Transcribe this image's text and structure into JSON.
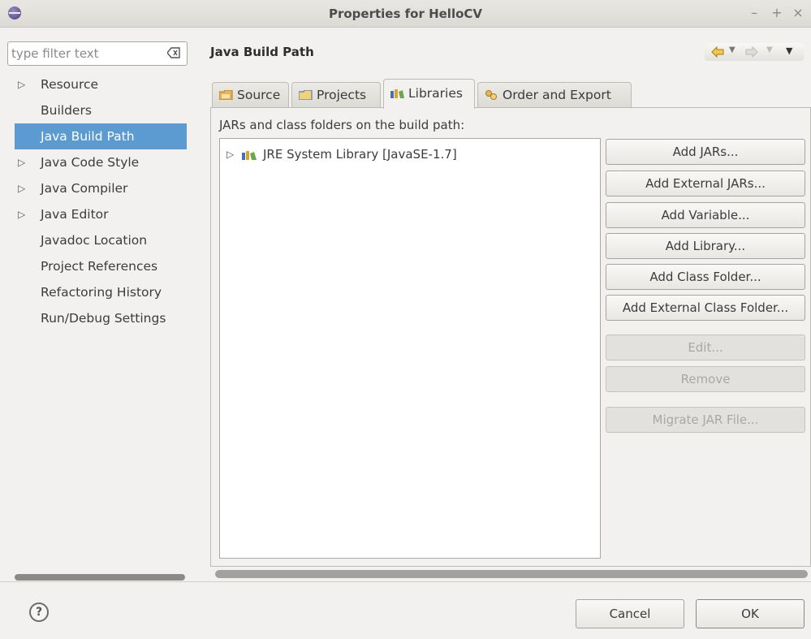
{
  "window": {
    "title": "Properties for HelloCV",
    "controls": [
      "–",
      "+",
      "×"
    ]
  },
  "sidebar": {
    "filter_placeholder": "type filter text",
    "items": [
      {
        "label": "Resource",
        "expandable": true,
        "selected": false
      },
      {
        "label": "Builders",
        "expandable": false,
        "selected": false
      },
      {
        "label": "Java Build Path",
        "expandable": false,
        "selected": true
      },
      {
        "label": "Java Code Style",
        "expandable": true,
        "selected": false
      },
      {
        "label": "Java Compiler",
        "expandable": true,
        "selected": false
      },
      {
        "label": "Java Editor",
        "expandable": true,
        "selected": false
      },
      {
        "label": "Javadoc Location",
        "expandable": false,
        "selected": false
      },
      {
        "label": "Project References",
        "expandable": false,
        "selected": false
      },
      {
        "label": "Refactoring History",
        "expandable": false,
        "selected": false
      },
      {
        "label": "Run/Debug Settings",
        "expandable": false,
        "selected": false
      }
    ]
  },
  "main": {
    "title": "Java Build Path",
    "tabs": [
      {
        "label": "Source",
        "icon": "source-folder-icon",
        "active": false
      },
      {
        "label": "Projects",
        "icon": "projects-icon",
        "active": false
      },
      {
        "label": "Libraries",
        "icon": "libraries-icon",
        "active": true
      },
      {
        "label": "Order and Export",
        "icon": "order-export-icon",
        "active": false
      }
    ],
    "list_label": "JARs and class folders on the build path:",
    "libraries": [
      {
        "label": "JRE System Library [JavaSE-1.7]",
        "icon": "library-icon"
      }
    ],
    "buttons": [
      {
        "label": "Add JARs...",
        "enabled": true
      },
      {
        "label": "Add External JARs...",
        "enabled": true
      },
      {
        "label": "Add Variable...",
        "enabled": true
      },
      {
        "label": "Add Library...",
        "enabled": true
      },
      {
        "label": "Add Class Folder...",
        "enabled": true
      },
      {
        "label": "Add External Class Folder...",
        "enabled": true
      },
      {
        "label": "Edit...",
        "enabled": false
      },
      {
        "label": "Remove",
        "enabled": false
      },
      {
        "label": "Migrate JAR File...",
        "enabled": false
      }
    ]
  },
  "footer": {
    "help": "?",
    "cancel": "Cancel",
    "ok": "OK"
  },
  "colors": {
    "selection": "#5b9bd1",
    "background": "#f2f1f0"
  }
}
